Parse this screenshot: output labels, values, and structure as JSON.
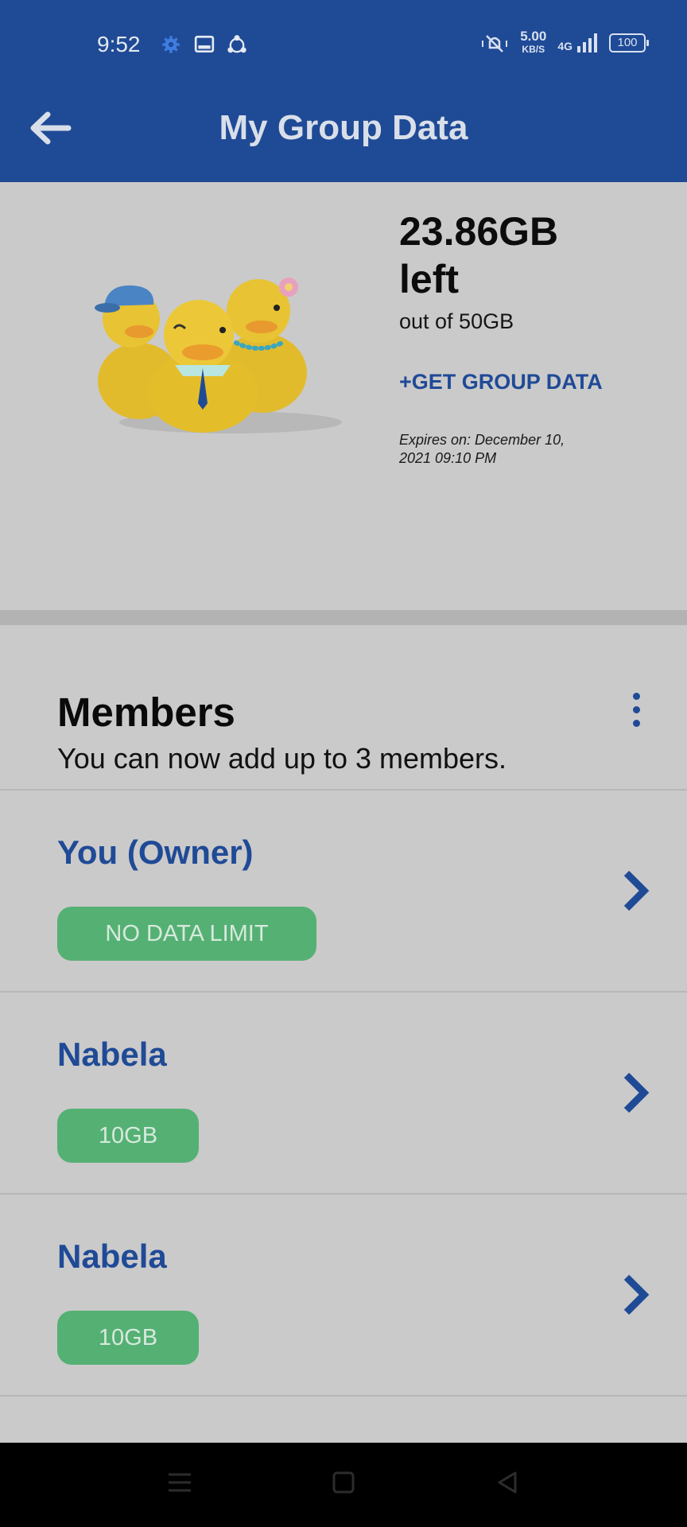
{
  "status_bar": {
    "time": "9:52",
    "net_speed_value": "5.00",
    "net_speed_unit": "KB/S",
    "network": "4G",
    "battery": "100",
    "icons": [
      "gear-icon",
      "gallery-icon",
      "share-icon",
      "vibrate-icon",
      "signal-icon"
    ]
  },
  "app_bar": {
    "title": "My Group Data",
    "back_icon": "arrow-left-icon",
    "color": "#1f4a96"
  },
  "summary": {
    "amount": "23.86GB",
    "left_word": "left",
    "out_of": "out of 50GB",
    "get_group_data": "+GET GROUP DATA",
    "expires_line1": "Expires on: December 10,",
    "expires_line2": "2021 09:10 PM"
  },
  "members": {
    "title": "Members",
    "subtitle": "You can now add up to 3 members.",
    "menu_icon": "more-vertical-icon",
    "list": [
      {
        "name": "You (Owner)",
        "badge": "NO DATA LIMIT"
      },
      {
        "name": "Nabela",
        "badge": "10GB"
      },
      {
        "name": "Nabela",
        "badge": "10GB"
      }
    ],
    "badge_color": "#55b074",
    "chevron_icon": "chevron-right-icon"
  },
  "nav_bar": {
    "icons": [
      "menu-icon",
      "home-square-icon",
      "back-triangle-icon"
    ]
  }
}
